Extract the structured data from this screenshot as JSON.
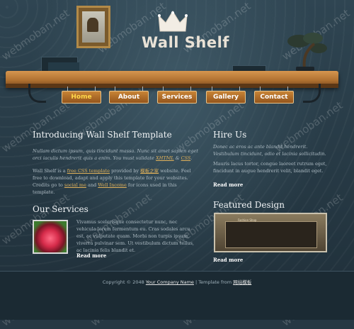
{
  "header": {
    "logo_text": "Wall Shelf"
  },
  "nav": {
    "items": [
      {
        "label": "Home",
        "active": true
      },
      {
        "label": "About",
        "active": false
      },
      {
        "label": "Services",
        "active": false
      },
      {
        "label": "Gallery",
        "active": false
      },
      {
        "label": "Contact",
        "active": false
      }
    ]
  },
  "intro": {
    "title": "Introducing Wall Shelf Template",
    "italic_line1": "Nullam dictum ipsum, quis tincidunt massa. Nunc sit amet sapien eget orci",
    "italic_line2_pre": "iaculis hendrerit quis a enim. You must validate ",
    "italic_link1": "XHTML",
    "italic_amp": " & ",
    "italic_link2": "CSS",
    "italic_end": ".",
    "body_pre": "Wall Shelf is a ",
    "body_link1": "free CSS template",
    "body_mid1": " provided by ",
    "body_link2": "模板之家",
    "body_mid2": " website. Feel free to download, adapt and apply this template for your websites. Credits go to ",
    "body_link3": "social me",
    "body_mid3": " and ",
    "body_link4": "Well Income",
    "body_end": " for icons used in this template."
  },
  "services": {
    "title": "Our Services",
    "text": "Vivamus scelerisque consectetur nunc, nec vehicula lorem fermentum eu. Cras sodales arcu est, ac vulputate quam. Morbi non turpis ipsum, viverra pulvinar sem. Ut vestibulum dictum tellus, ac lacinia felis blandit et.",
    "more": "Read more"
  },
  "hire": {
    "title": "Hire Us",
    "italic": "Donec ac eros ac ante blandit hendrerit. Vestibulum tincidunt, odio et lacinia sollicitudin.",
    "text": "Mauris lacus tortor, congue laoreet rutrum eget, fincidunt in augue hendrerit velit, blandit eget.",
    "more": "Read more"
  },
  "featured": {
    "title": "Featured Design",
    "preview_title": "Fashion Shop",
    "more": "Read more"
  },
  "footer": {
    "pre": "Copyright © 2048 ",
    "company": "Your Company Name",
    "mid": " | Template from ",
    "source": "网站模板"
  },
  "watermark": "webmoban.net"
}
